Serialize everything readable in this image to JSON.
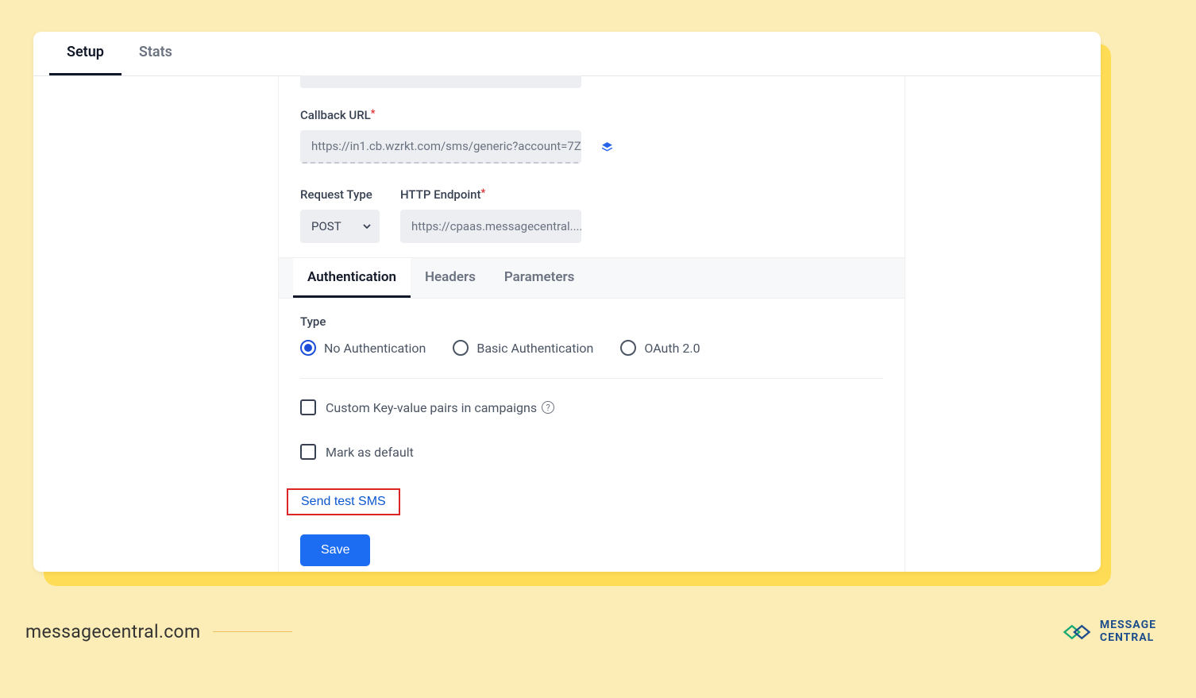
{
  "top_tabs": {
    "setup": "Setup",
    "stats": "Stats"
  },
  "form": {
    "callback_label": "Callback URL",
    "callback_value": "https://in1.cb.wzrkt.com/sms/generic?account=7Z...",
    "request_type_label": "Request Type",
    "request_type_value": "POST",
    "http_endpoint_label": "HTTP Endpoint",
    "http_endpoint_value": "https://cpaas.messagecentral...."
  },
  "sub_tabs": {
    "auth": "Authentication",
    "headers": "Headers",
    "params": "Parameters"
  },
  "auth": {
    "type_label": "Type",
    "options": {
      "none": "No Authentication",
      "basic": "Basic Authentication",
      "oauth": "OAuth 2.0"
    },
    "custom_kv": "Custom Key-value pairs in campaigns",
    "mark_default": "Mark as default",
    "send_test": "Send test SMS",
    "save": "Save"
  },
  "footer": {
    "url": "messagecentral.com",
    "logo_line1": "MESSAGE",
    "logo_line2": "CENTRAL"
  }
}
